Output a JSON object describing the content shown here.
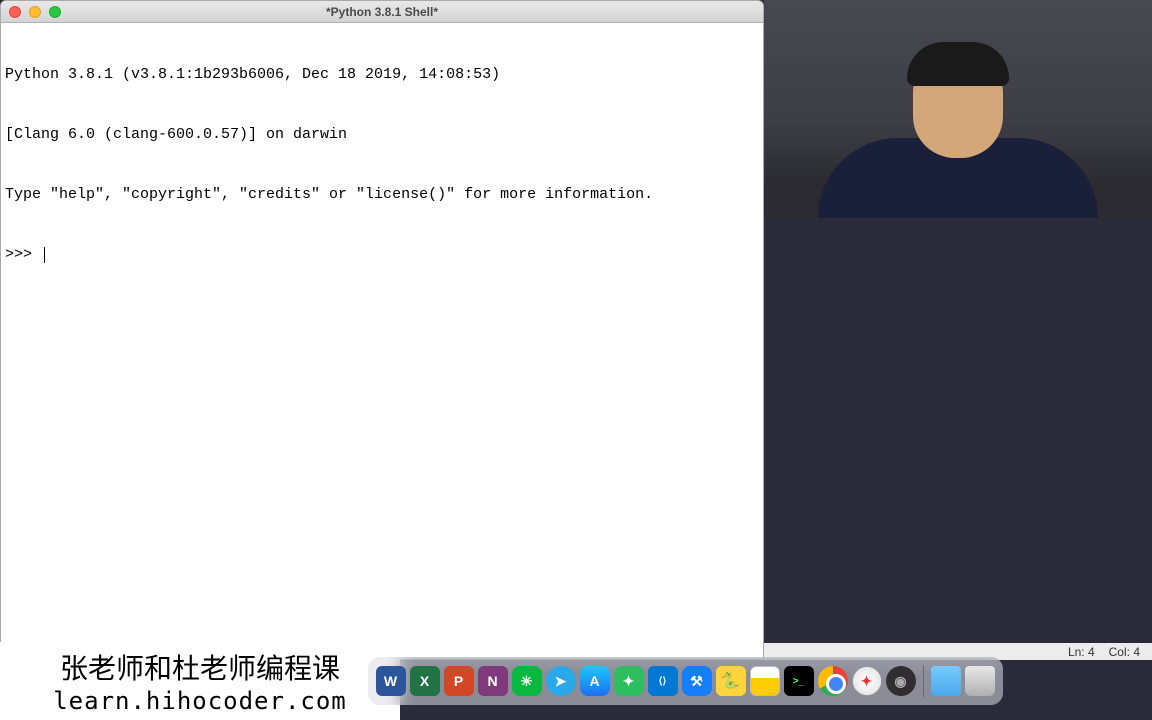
{
  "window": {
    "title": "*Python 3.8.1 Shell*"
  },
  "shell": {
    "line1": "Python 3.8.1 (v3.8.1:1b293b6006, Dec 18 2019, 14:08:53) ",
    "line2": "[Clang 6.0 (clang-600.0.57)] on darwin",
    "line3": "Type \"help\", \"copyright\", \"credits\" or \"license()\" for more information.",
    "prompt": ">>> "
  },
  "status": {
    "line": "Ln: 4",
    "col": "Col: 4"
  },
  "branding": {
    "cn": "张老师和杜老师编程课",
    "url": "learn.hihocoder.com"
  },
  "dock": {
    "word": "W",
    "excel": "X",
    "ppt": "P",
    "onenote": "N",
    "wechat": "✳",
    "telegram": "➤",
    "appstore": "A",
    "evernote": "✦",
    "vscode": "⟨⟩",
    "xcode": "⚒",
    "python": "🐍",
    "notes": "",
    "terminal": ">_",
    "chrome": "",
    "safari": "✦",
    "obs": "◉",
    "folder": "",
    "trash": ""
  }
}
